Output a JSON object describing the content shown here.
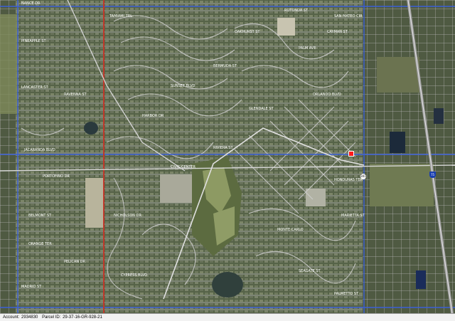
{
  "footer": {
    "account_label": "Account",
    "account_value": "2934830",
    "parcel_label": "Parcel ID",
    "parcel_value": "29-37-16-GR-928-21"
  },
  "markers": {
    "route_shield": "301",
    "interstate_shield": "75",
    "parcel_marker_color": "#ff1a1a"
  },
  "colors": {
    "terrain": "#5d6a4f",
    "streets": "#c9c9c9",
    "major_roads_blue": "#3b5fd6",
    "major_roads_red": "#c0392b",
    "highway": "#9a9a9a"
  },
  "street_labels": [
    "NANCE DR",
    "ROTONDA ST",
    "SAN MATEO CIR",
    "PINEAPPLE ST",
    "LANCASTER ST",
    "RAVENNA ST",
    "JACARANDA BLVD",
    "PORTOFINO DR",
    "TAMIAMI TRL",
    "SUNSET BLVD",
    "OAKHURST ST",
    "PALM AVE",
    "CAYMAN ST",
    "RIVIERA ST",
    "ORLANDO BLVD",
    "HONDURAS TER",
    "MARIETTA ST",
    "CIVIC CENTER",
    "NICHOLSON DR",
    "BELMONT ST",
    "PELICAN DR",
    "MADRID ST",
    "CYPRESS BLVD",
    "SEAGATE ST",
    "GLENDALE ST",
    "MONTE CARLO",
    "PALMETTO ST",
    "BERMUDA ST",
    "HARBOR DR",
    "ORANGE TER"
  ]
}
